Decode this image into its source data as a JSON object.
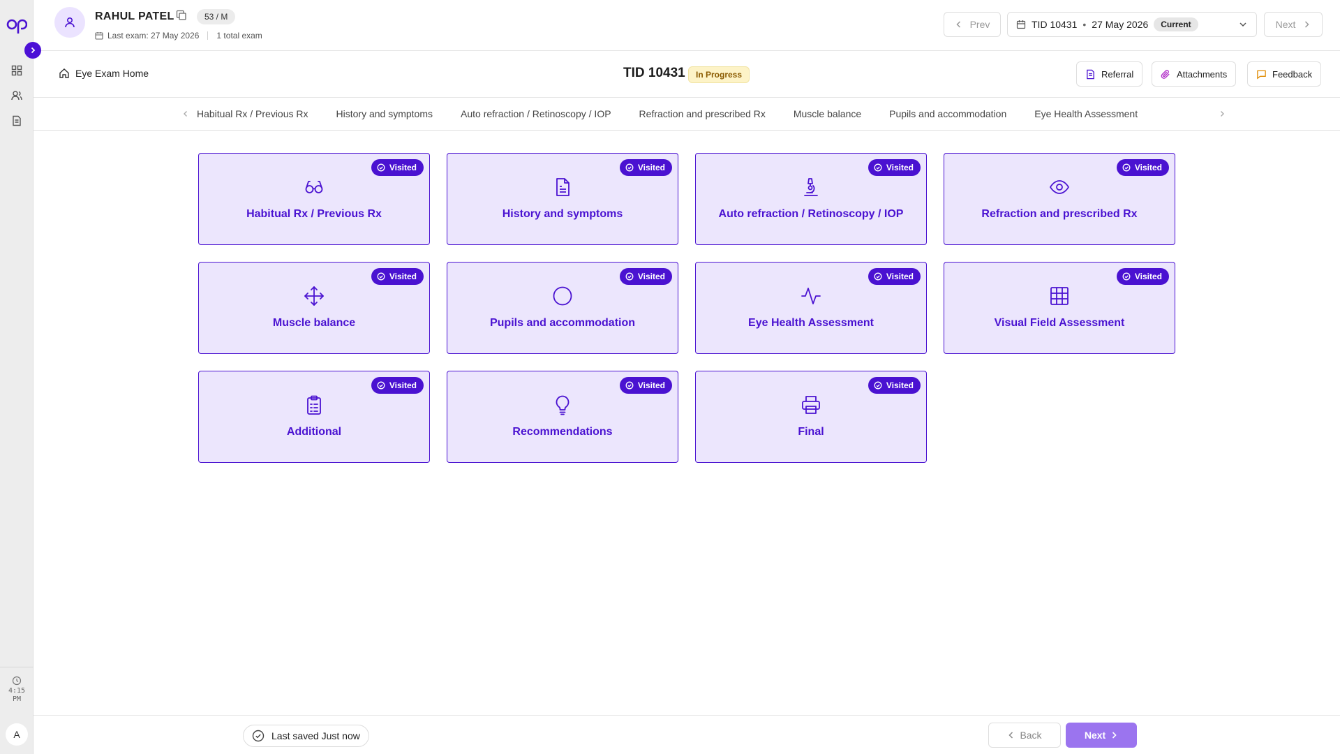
{
  "patient": {
    "name": "RAHUL PATEL",
    "age_sex": "53 / M",
    "last_exam": "Last exam: 27 May 2026",
    "total_exams": "1 total exam"
  },
  "top_nav": {
    "prev_label": "Prev",
    "next_label": "Next",
    "selected_tid": "TID 10431",
    "selected_date": "27 May 2026",
    "selected_badge": "Current"
  },
  "subheader": {
    "home_label": "Eye Exam Home",
    "tid_title": "TID 10431",
    "status": "In Progress",
    "actions": [
      "Referral",
      "Attachments",
      "Feedback"
    ]
  },
  "tabs": [
    "Habitual Rx / Previous Rx",
    "History and symptoms",
    "Auto refraction / Retinoscopy / IOP",
    "Refraction and prescribed Rx",
    "Muscle balance",
    "Pupils and accommodation",
    "Eye Health Assessment"
  ],
  "cards": [
    {
      "title": "Habitual Rx / Previous Rx",
      "icon": "glasses-icon",
      "badge": "Visited"
    },
    {
      "title": "History and symptoms",
      "icon": "document-icon",
      "badge": "Visited"
    },
    {
      "title": "Auto refraction / Retinoscopy / IOP",
      "icon": "microscope-icon",
      "badge": "Visited"
    },
    {
      "title": "Refraction and prescribed Rx",
      "icon": "eye-icon",
      "badge": "Visited"
    },
    {
      "title": "Muscle balance",
      "icon": "move-icon",
      "badge": "Visited"
    },
    {
      "title": "Pupils and accommodation",
      "icon": "circle-icon",
      "badge": "Visited"
    },
    {
      "title": "Eye Health Assessment",
      "icon": "activity-icon",
      "badge": "Visited"
    },
    {
      "title": "Visual Field Assessment",
      "icon": "grid-icon",
      "badge": "Visited"
    },
    {
      "title": "Additional",
      "icon": "clipboard-icon",
      "badge": "Visited"
    },
    {
      "title": "Recommendations",
      "icon": "lightbulb-icon",
      "badge": "Visited"
    },
    {
      "title": "Final",
      "icon": "printer-icon",
      "badge": "Visited"
    }
  ],
  "sidebar": {
    "clock_time": "4:15",
    "clock_period": "PM",
    "user_initial": "A"
  },
  "footer": {
    "saved_status": "Last saved Just now",
    "back_label": "Back",
    "next_label": "Next"
  },
  "colors": {
    "accent": "#4a12d1",
    "card_bg": "#ece6fd",
    "next_button": "#9b74ef",
    "status_pill_bg": "#fdf3c7"
  }
}
